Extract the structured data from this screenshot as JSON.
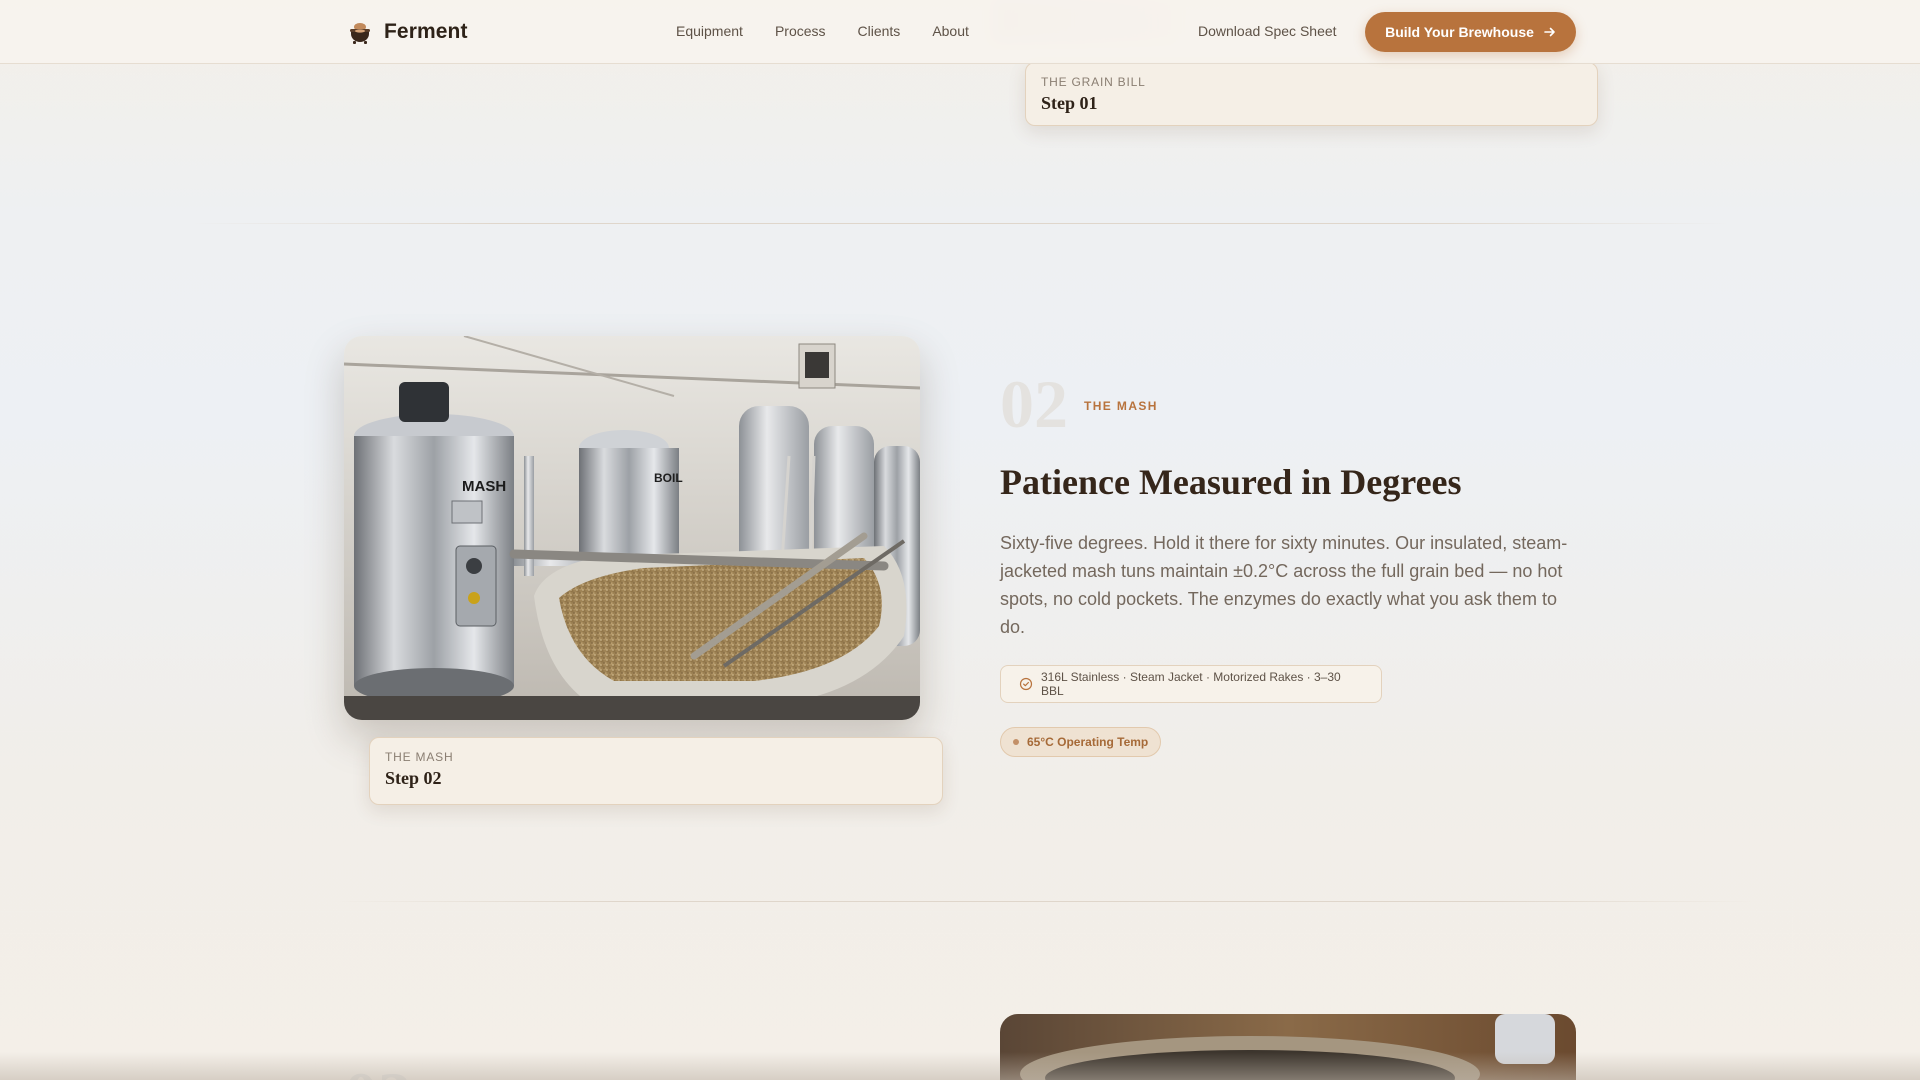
{
  "nav": {
    "brand_name": "Ferment",
    "brand_icon": "cauldron-icon",
    "links": [
      {
        "label": "Equipment"
      },
      {
        "label": "Process"
      },
      {
        "label": "Clients"
      },
      {
        "label": "About"
      }
    ],
    "secondary_link": "Download Spec Sheet",
    "cta_label": "Build Your Brewhouse",
    "cta_icon": "arrow-right-icon"
  },
  "step1_card": {
    "eyebrow": "THE GRAIN BILL",
    "title": "Step 01"
  },
  "step2": {
    "number": "02",
    "kicker": "THE MASH",
    "heading": "Patience Measured in Degrees",
    "body": "Sixty-five degrees. Hold it there for sixty minutes. Our insulated, steam-jacketed mash tuns maintain ±0.2°C across the full grain bed — no hot spots, no cold pockets. The enzymes do exactly what you ask them to do.",
    "specs": "316L Stainless · Steam Jacket · Motorized Rakes · 3–30 BBL",
    "spec_icon": "check-circle-icon",
    "temp_badge": "65°C Operating Temp",
    "photo_label": "MASH",
    "photo_label_2": "BOIL",
    "card": {
      "eyebrow": "THE MASH",
      "title": "Step 02"
    }
  },
  "colors": {
    "accent": "#b8733d",
    "heading": "#35261a",
    "body": "#74685d"
  }
}
